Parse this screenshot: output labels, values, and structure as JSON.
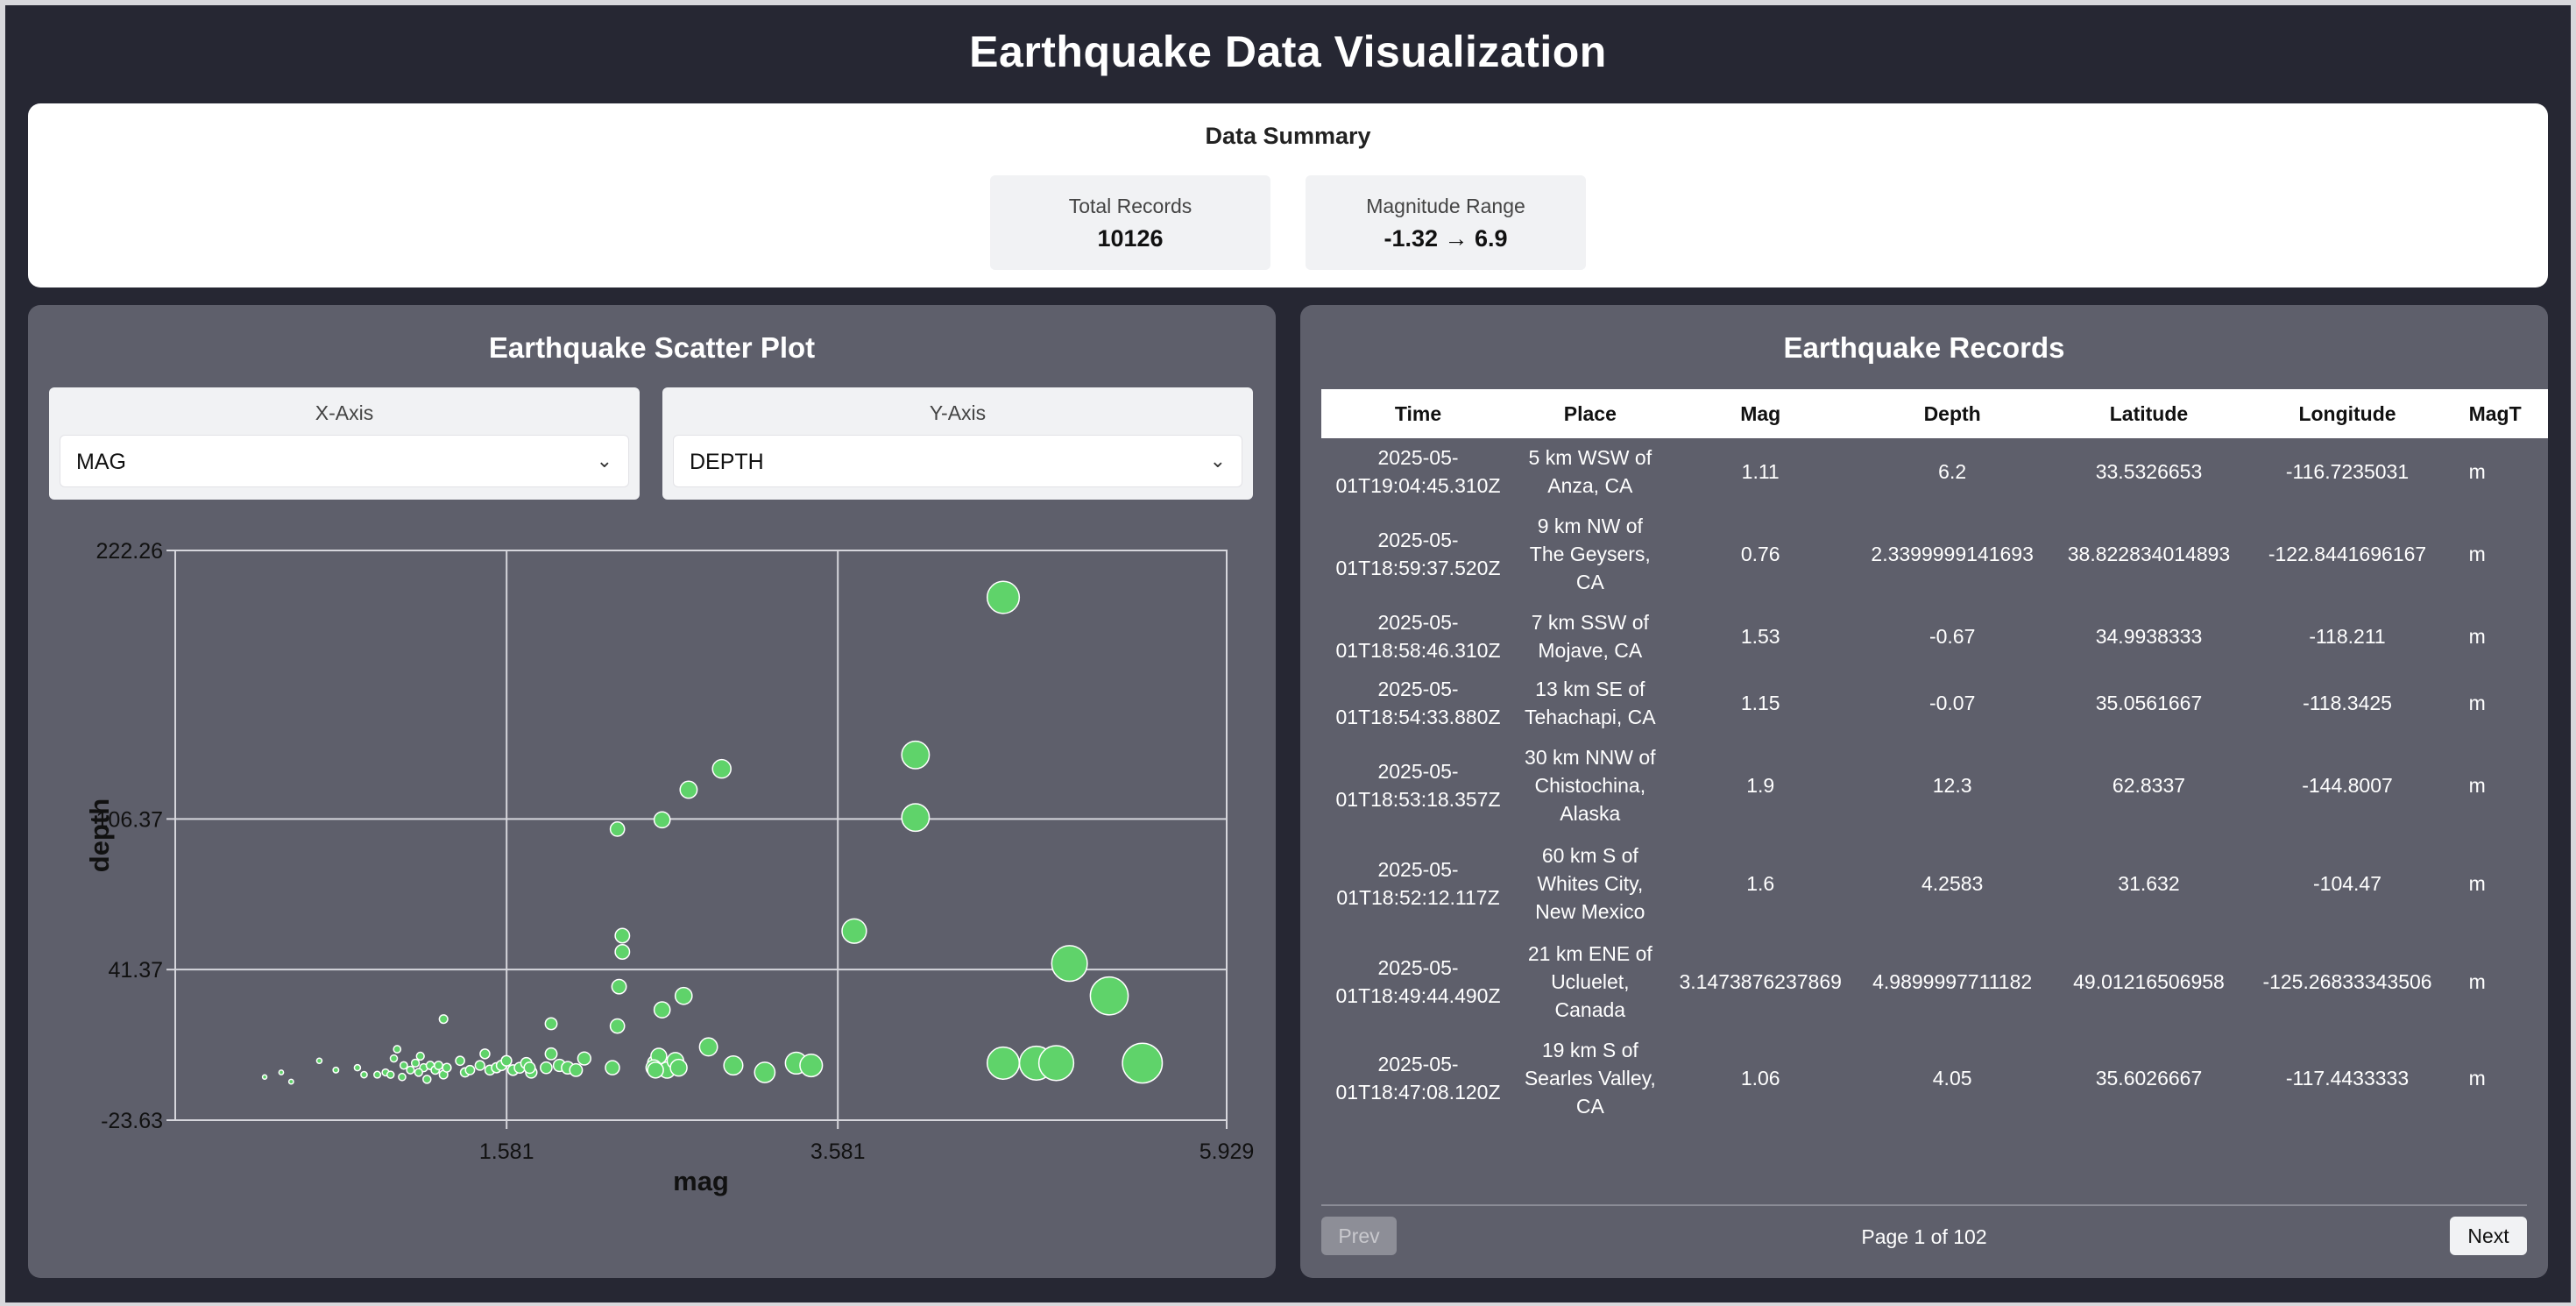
{
  "app": {
    "title": "Earthquake Data Visualization"
  },
  "summary": {
    "title": "Data Summary",
    "stats": [
      {
        "label": "Total Records",
        "value": "10126"
      },
      {
        "label": "Magnitude Range",
        "value": "-1.32 → 6.9"
      }
    ]
  },
  "scatter": {
    "title": "Earthquake Scatter Plot",
    "x_axis": {
      "label": "X-Axis",
      "selected": "MAG"
    },
    "y_axis": {
      "label": "Y-Axis",
      "selected": "DEPTH"
    }
  },
  "chart_data": {
    "type": "scatter",
    "xlabel": "mag",
    "ylabel": "depth",
    "xlim": [
      -0.42,
      5.929
    ],
    "ylim": [
      -23.63,
      222.26
    ],
    "x_ticks": [
      "1.581",
      "3.581",
      "5.929"
    ],
    "y_ticks": [
      "222.26",
      "106.37",
      "41.37",
      "-23.63"
    ],
    "grid": true,
    "point_color": "#5fd36a",
    "points": [
      [
        0.12,
        -5
      ],
      [
        0.22,
        -3
      ],
      [
        0.28,
        -7
      ],
      [
        0.45,
        2
      ],
      [
        0.55,
        -2
      ],
      [
        0.68,
        -1
      ],
      [
        0.72,
        -4
      ],
      [
        0.8,
        -4
      ],
      [
        0.85,
        -3
      ],
      [
        0.88,
        -4
      ],
      [
        0.9,
        3
      ],
      [
        0.92,
        7
      ],
      [
        0.96,
        0
      ],
      [
        1.0,
        -2
      ],
      [
        1.03,
        1
      ],
      [
        1.06,
        4
      ],
      [
        1.08,
        -1
      ],
      [
        1.1,
        -6
      ],
      [
        1.12,
        0
      ],
      [
        1.15,
        -2
      ],
      [
        1.17,
        0
      ],
      [
        1.2,
        -4
      ],
      [
        1.22,
        -1
      ],
      [
        1.3,
        2
      ],
      [
        1.33,
        -3
      ],
      [
        1.36,
        -2
      ],
      [
        1.42,
        0
      ],
      [
        1.45,
        5
      ],
      [
        1.48,
        -2
      ],
      [
        1.52,
        -1
      ],
      [
        1.55,
        0
      ],
      [
        1.58,
        2
      ],
      [
        1.62,
        -2
      ],
      [
        1.66,
        -1
      ],
      [
        1.7,
        1
      ],
      [
        1.73,
        -3
      ],
      [
        1.82,
        -1
      ],
      [
        1.85,
        18
      ],
      [
        1.85,
        5
      ],
      [
        1.9,
        0
      ],
      [
        1.95,
        -1
      ],
      [
        2.0,
        -2
      ],
      [
        2.05,
        3
      ],
      [
        2.22,
        -1
      ],
      [
        2.25,
        102
      ],
      [
        2.25,
        17
      ],
      [
        2.28,
        49
      ],
      [
        2.28,
        56
      ],
      [
        2.48,
        1
      ],
      [
        2.5,
        4
      ],
      [
        2.52,
        106
      ],
      [
        2.52,
        24
      ],
      [
        2.55,
        -2
      ],
      [
        2.6,
        2
      ],
      [
        2.62,
        -1
      ],
      [
        2.65,
        30
      ],
      [
        2.68,
        119
      ],
      [
        2.8,
        8
      ],
      [
        2.88,
        128
      ],
      [
        2.95,
        0
      ],
      [
        1.2,
        20
      ],
      [
        2.47,
        -1
      ],
      [
        2.48,
        -2
      ],
      [
        3.14,
        -3
      ],
      [
        3.33,
        1
      ],
      [
        3.42,
        0
      ],
      [
        3.68,
        58
      ],
      [
        4.05,
        107
      ],
      [
        4.05,
        134
      ],
      [
        4.58,
        202
      ],
      [
        4.58,
        1
      ],
      [
        4.78,
        1
      ],
      [
        4.9,
        1
      ],
      [
        4.98,
        44
      ],
      [
        5.22,
        30
      ],
      [
        5.42,
        1
      ],
      [
        1.72,
        -1
      ],
      [
        1.05,
        -3
      ],
      [
        0.95,
        -5
      ],
      [
        2.26,
        34
      ]
    ]
  },
  "records": {
    "title": "Earthquake Records",
    "columns": [
      "Time",
      "Place",
      "Mag",
      "Depth",
      "Latitude",
      "Longitude",
      "MagT"
    ],
    "rows": [
      {
        "time": "2025-05-01T19:04:45.310Z",
        "place": "5 km WSW of Anza, CA",
        "mag": "1.11",
        "depth": "6.2",
        "lat": "33.5326653",
        "lon": "-116.7235031",
        "magtype": "m"
      },
      {
        "time": "2025-05-01T18:59:37.520Z",
        "place": "9 km NW of The Geysers, CA",
        "mag": "0.76",
        "depth": "2.3399999141693",
        "lat": "38.822834014893",
        "lon": "-122.8441696167",
        "magtype": "m"
      },
      {
        "time": "2025-05-01T18:58:46.310Z",
        "place": "7 km SSW of Mojave, CA",
        "mag": "1.53",
        "depth": "-0.67",
        "lat": "34.9938333",
        "lon": "-118.211",
        "magtype": "m"
      },
      {
        "time": "2025-05-01T18:54:33.880Z",
        "place": "13 km SE of Tehachapi, CA",
        "mag": "1.15",
        "depth": "-0.07",
        "lat": "35.0561667",
        "lon": "-118.3425",
        "magtype": "m"
      },
      {
        "time": "2025-05-01T18:53:18.357Z",
        "place": "30 km NNW of Chistochina, Alaska",
        "mag": "1.9",
        "depth": "12.3",
        "lat": "62.8337",
        "lon": "-144.8007",
        "magtype": "m"
      },
      {
        "time": "2025-05-01T18:52:12.117Z",
        "place": "60 km S of Whites City, New Mexico",
        "mag": "1.6",
        "depth": "4.2583",
        "lat": "31.632",
        "lon": "-104.47",
        "magtype": "m"
      },
      {
        "time": "2025-05-01T18:49:44.490Z",
        "place": "21 km ENE of Ucluelet, Canada",
        "mag": "3.1473876237869",
        "depth": "4.9899997711182",
        "lat": "49.01216506958",
        "lon": "-125.26833343506",
        "magtype": "m"
      },
      {
        "time": "2025-05-01T18:47:08.120Z",
        "place": "19 km S of Searles Valley, CA",
        "mag": "1.06",
        "depth": "4.05",
        "lat": "35.6026667",
        "lon": "-117.4433333",
        "magtype": "m"
      }
    ],
    "pager": {
      "prev": "Prev",
      "next": "Next",
      "info": "Page 1 of 102"
    }
  }
}
